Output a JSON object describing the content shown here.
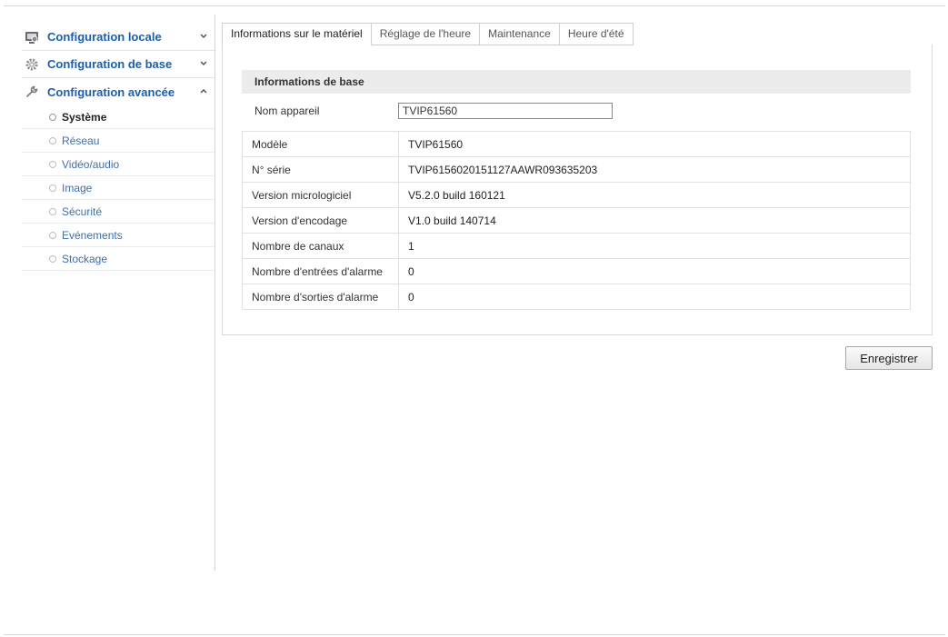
{
  "sidebar": {
    "local": {
      "label": "Configuration locale",
      "icon": "monitor-settings-icon",
      "arrow": "chevron-down-icon"
    },
    "basic": {
      "label": "Configuration de base",
      "icon": "gear-icon",
      "arrow": "chevron-down-icon"
    },
    "advanced": {
      "label": "Configuration avancée",
      "icon": "wrench-icon",
      "arrow": "chevron-up-icon",
      "items": [
        {
          "label": "Système",
          "active": true
        },
        {
          "label": "Réseau"
        },
        {
          "label": "Vidéo/audio"
        },
        {
          "label": "Image"
        },
        {
          "label": "Sécurité"
        },
        {
          "label": "Evénements"
        },
        {
          "label": "Stockage"
        }
      ]
    }
  },
  "tabs": [
    {
      "label": "Informations sur le matériel",
      "active": true
    },
    {
      "label": "Réglage de l'heure"
    },
    {
      "label": "Maintenance"
    },
    {
      "label": "Heure d'été"
    }
  ],
  "panel": {
    "group_title": "Informations de base",
    "device_name": {
      "label": "Nom appareil",
      "value": "TVIP61560"
    },
    "rows": [
      {
        "key": "Modèle",
        "value": "TVIP61560"
      },
      {
        "key": "N° série",
        "value": "TVIP6156020151127AAWR093635203"
      },
      {
        "key": "Version micrologiciel",
        "value": "V5.2.0 build 160121"
      },
      {
        "key": "Version d'encodage",
        "value": "V1.0 build 140714"
      },
      {
        "key": "Nombre de canaux",
        "value": "1"
      },
      {
        "key": "Nombre d'entrées d'alarme",
        "value": "0"
      },
      {
        "key": "Nombre d'sorties d'alarme",
        "value": "0"
      }
    ]
  },
  "actions": {
    "save_label": "Enregistrer"
  },
  "colors": {
    "link": "#1b5eaa",
    "sub_link": "#3d6fb0",
    "header_bg": "#ececec"
  }
}
